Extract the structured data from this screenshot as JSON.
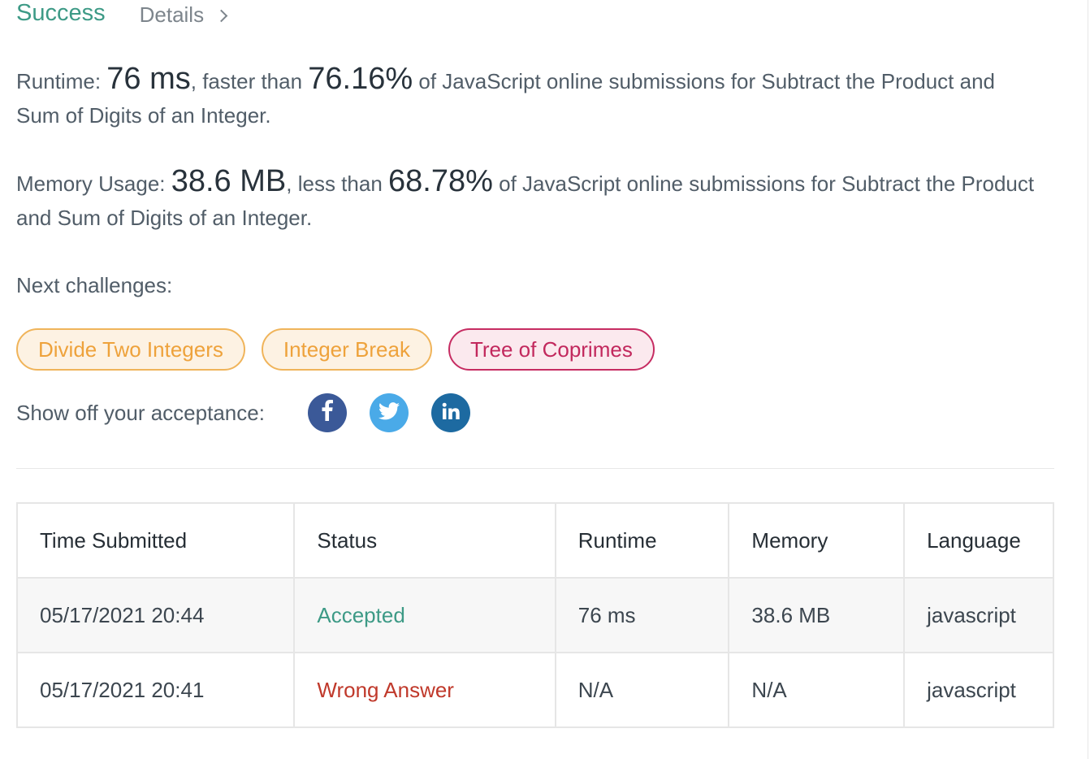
{
  "header": {
    "status": "Success",
    "details_label": "Details"
  },
  "runtime_stat": {
    "label": "Runtime: ",
    "value": "76 ms",
    "comparison": ", faster than ",
    "percent": "76.16%",
    "suffix": " of JavaScript online submissions for Subtract the Product and Sum of Digits of an Integer."
  },
  "memory_stat": {
    "label": "Memory Usage: ",
    "value": "38.6 MB",
    "comparison": ", less than ",
    "percent": "68.78%",
    "suffix": " of JavaScript online submissions for Subtract the Product and Sum of Digits of an Integer."
  },
  "next_challenges": {
    "label": "Next challenges:",
    "items": [
      {
        "title": "Divide Two Integers",
        "difficulty": "medium"
      },
      {
        "title": "Integer Break",
        "difficulty": "medium"
      },
      {
        "title": "Tree of Coprimes",
        "difficulty": "hard"
      }
    ]
  },
  "share": {
    "label": "Show off your acceptance:",
    "icons": [
      "facebook-icon",
      "twitter-icon",
      "linkedin-icon"
    ]
  },
  "submissions": {
    "headers": [
      "Time Submitted",
      "Status",
      "Runtime",
      "Memory",
      "Language"
    ],
    "rows": [
      {
        "time": "05/17/2021 20:44",
        "status": "Accepted",
        "runtime": "76 ms",
        "memory": "38.6 MB",
        "language": "javascript"
      },
      {
        "time": "05/17/2021 20:41",
        "status": "Wrong Answer",
        "runtime": "N/A",
        "memory": "N/A",
        "language": "javascript"
      }
    ]
  },
  "colors": {
    "success": "#3d9a86",
    "wrong": "#c0392b",
    "medium": "#eea23b",
    "hard": "#c2285d",
    "facebook": "#3b5998",
    "twitter": "#4aaae8",
    "linkedin": "#1d6aa1"
  }
}
